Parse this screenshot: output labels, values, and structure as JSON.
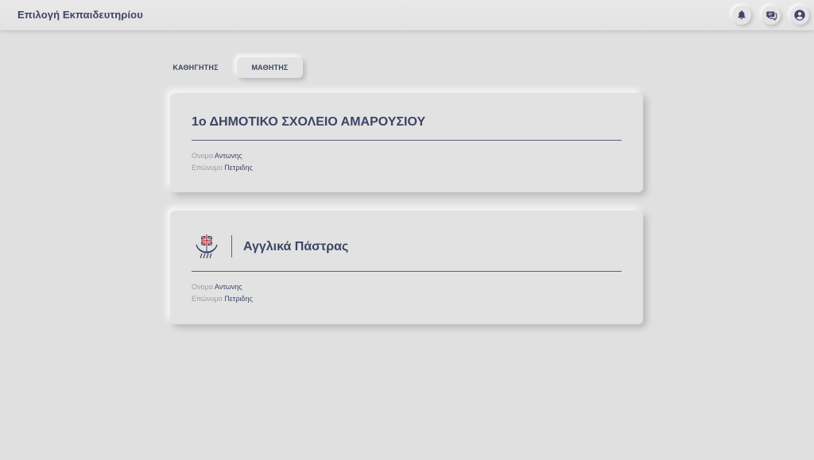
{
  "app": {
    "title": "Επιλογή Εκπαιδευτηρίου"
  },
  "header_icons": [
    {
      "name": "bell-icon"
    },
    {
      "name": "chat-icon"
    },
    {
      "name": "user-icon"
    }
  ],
  "tabs": [
    {
      "label": "ΚΑΘΗΓΗΤΗΣ",
      "active": false
    },
    {
      "label": "ΜΑΘΗΤΗΣ",
      "active": true
    }
  ],
  "cards": [
    {
      "title": "1ο ΔΗΜΟΤΙΚΟ ΣΧΟΛΕΙΟ ΑΜΑΡΟΥΣΙΟΥ",
      "first_name_label": "Ονομα",
      "first_name": "Αντωνης",
      "last_name_label": "Επώνυμο",
      "last_name": "Πετριδης"
    },
    {
      "title": "Αγγλικά Πάστρας",
      "logo_icon": "ship-logo-icon",
      "first_name_label": "Ονομα",
      "first_name": "Αντωνης",
      "last_name_label": "Επώνυμο",
      "last_name": "Πετριδης"
    }
  ],
  "colors": {
    "background": "#e0e0e0",
    "text_primary": "#3d4566",
    "label_muted": "#9a9ca4",
    "logo_red": "#c0303a"
  }
}
